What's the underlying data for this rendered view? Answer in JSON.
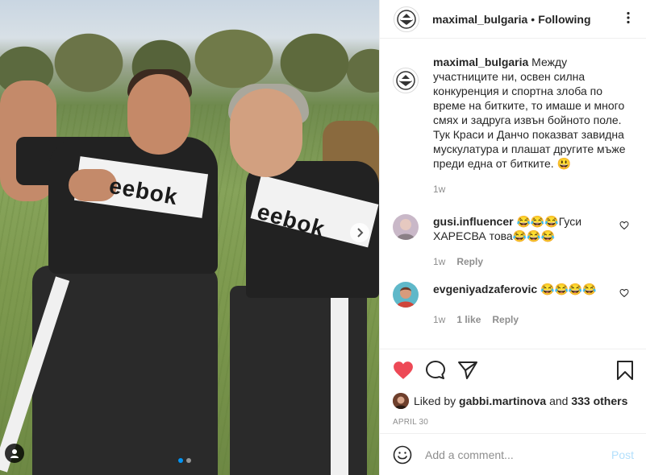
{
  "post": {
    "username": "maximal_bulgaria",
    "separator": "•",
    "follow_status": "Following"
  },
  "caption": {
    "username": "maximal_bulgaria",
    "text": "Между участниците ни, освен силна конкуренция и спортна злоба по време на битките, то имаше и много смях и задруга извън бойното поле. Тук Краси и Данчо показват завидна мускулатура и плашат другите мъже преди една от битките. 😃",
    "time": "1w"
  },
  "comments": [
    {
      "username": "gusi.influencer",
      "text": "😂😂😂Гуси ХАРЕСВА това😂😂😂",
      "time": "1w",
      "likes": "",
      "reply": "Reply"
    },
    {
      "username": "evgeniyadzaferovic",
      "text": "😂😂😂😂",
      "time": "1w",
      "likes": "1 like",
      "reply": "Reply"
    }
  ],
  "likes": {
    "prefix": "Liked by",
    "user": "gabbi.martinova",
    "and": "and",
    "others": "333 others"
  },
  "date": "APRIL 30",
  "add_comment": {
    "placeholder": "Add a comment...",
    "post_label": "Post"
  },
  "photo": {
    "logo_text": "eebok"
  },
  "colors": {
    "heart": "#ed4956",
    "post_button": "#b2dffc",
    "active_dot": "#0095f6"
  }
}
